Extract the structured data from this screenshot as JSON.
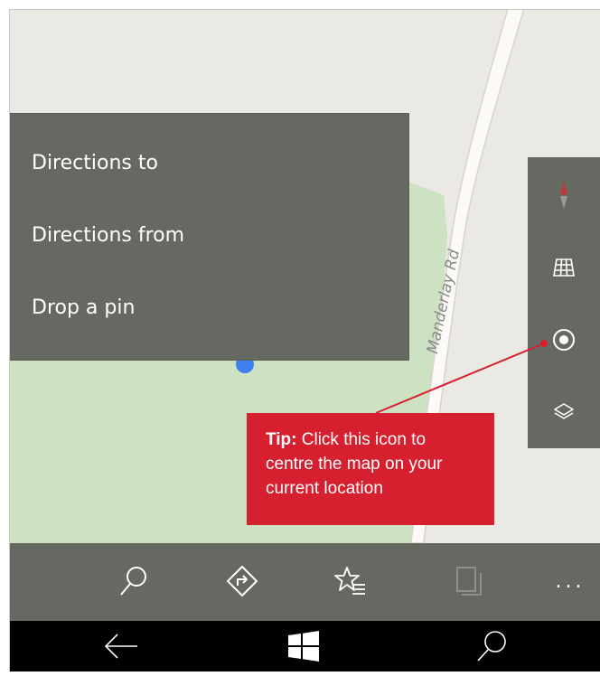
{
  "map": {
    "road_label": "Manderlay Rd"
  },
  "context_menu": {
    "items": [
      {
        "label": "Directions to"
      },
      {
        "label": "Directions from"
      },
      {
        "label": "Drop a pin"
      }
    ]
  },
  "map_controls": [
    {
      "icon": "compass-icon"
    },
    {
      "icon": "map-grid-icon"
    },
    {
      "icon": "current-location-icon"
    },
    {
      "icon": "layers-icon"
    }
  ],
  "tip": {
    "prefix": "Tip:",
    "text": " Click this icon to centre the map on your current location",
    "accent_color": "#d7202f"
  },
  "app_bar": {
    "buttons": [
      {
        "icon": "search-icon"
      },
      {
        "icon": "directions-icon"
      },
      {
        "icon": "favorites-icon"
      },
      {
        "icon": "collections-icon"
      },
      {
        "icon": "more-icon",
        "label": "..."
      }
    ]
  },
  "nav_bar": {
    "buttons": [
      {
        "icon": "back-arrow-icon"
      },
      {
        "icon": "windows-start-icon"
      },
      {
        "icon": "search-icon"
      }
    ]
  }
}
